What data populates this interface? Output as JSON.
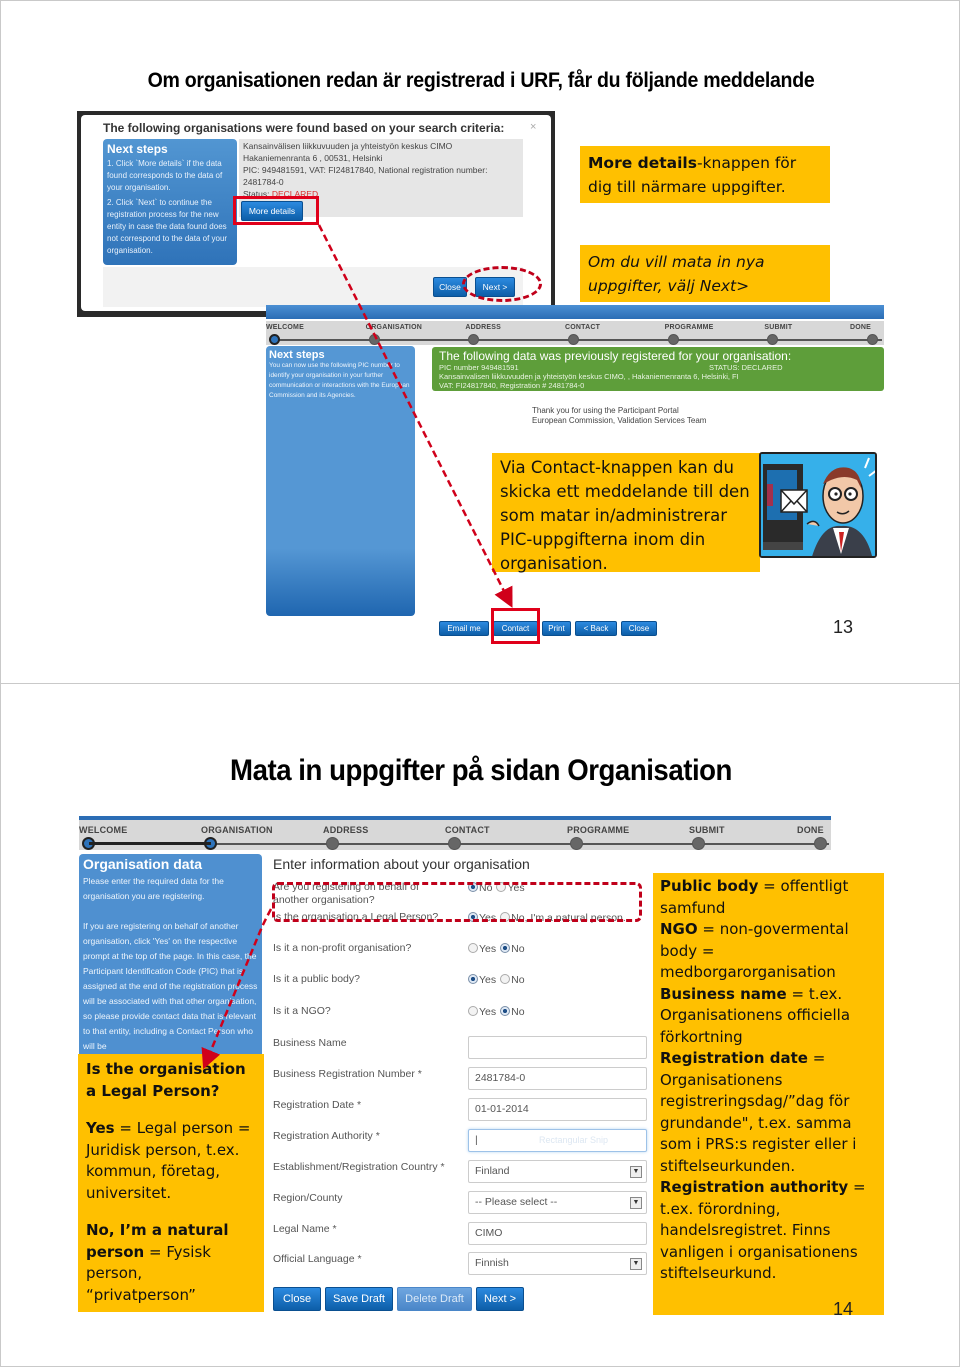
{
  "slide1": {
    "title": "Om organisationen redan är registrerad i URF, får du följande meddelande",
    "dialog": {
      "title": "The following organisations were found based on your search criteria:",
      "close_icon": "×",
      "next_steps_heading": "Next steps",
      "next_steps_1": "1. Click `More details` if the data found corresponds to the data of your organisation.",
      "next_steps_2": "2. Click `Next` to continue the registration process for the new entity in case the data found does not correspond to the data of your organisation.",
      "org_name": "Kansainvälisen liikkuvuuden ja yhteistyön keskus CIMO",
      "org_address": "Hakaniemenranta 6 , 00531, Helsinki",
      "org_ids": "PIC: 949481591, VAT: FI24817840, National registration number: 2481784-0",
      "status_label": "Status: ",
      "status_value": "DECLARED",
      "more_details_button": "More details",
      "close_button": "Close",
      "next_button": "Next >"
    },
    "callout_more_details_bold": "More details",
    "callout_more_details_rest": "-knappen för dig till närmare uppgifter.",
    "callout_next": "Om du vill mata in nya uppgifter, välj Next>",
    "wizard_steps": [
      "WELCOME",
      "ORGANISATION",
      "ADDRESS",
      "CONTACT",
      "PROGRAMME",
      "SUBMIT",
      "DONE"
    ],
    "next_steps_panel": {
      "heading": "Next steps",
      "text": "You can now use the following PIC number to identify your organisation in your further communication or interactions with the European Commission and its Agencies."
    },
    "registered_box": {
      "title": "The following data was previously registered for your organisation:",
      "pic": "PIC number 949481591",
      "status": "STATUS: DECLARED",
      "address": "Kansainvalisen liikkuvuuden ja yhteistyön keskus CIMO, , Hakaniemenranta 6, Helsinki, FI",
      "vat": "VAT: FI24817840, Registration # 2481784-0"
    },
    "thanks_line1": "Thank you for using the Participant Portal",
    "thanks_line2": "European Commission, Validation Services Team",
    "callout_contact": "Via Contact-knappen kan du skicka ett meddelande till den som matar in/administrerar PIC-uppgifterna inom din organisation.",
    "buttons": [
      "Email me",
      "Contact",
      "Print",
      "< Back",
      "Close"
    ],
    "page_number": "13"
  },
  "slide2": {
    "title": "Mata in uppgifter på sidan Organisation",
    "wizard_steps": [
      "WELCOME",
      "ORGANISATION",
      "ADDRESS",
      "CONTACT",
      "PROGRAMME",
      "SUBMIT",
      "DONE"
    ],
    "org_panel": {
      "heading": "Organisation data",
      "text1": "Please enter the required data for the organisation you are registering.",
      "text2": "If you are registering on behalf of another organisation, click 'Yes' on the respective prompt at the top of the page. In this case, the Participant Identification Code (PIC) that is assigned at the end of the registration process will be associated with that other organisation, so please provide contact data that is relevant to that entity, including a Contact Person who will be"
    },
    "form_title": "Enter information about your organisation",
    "questions": [
      {
        "label": "Are you registering on behalf of another organisation?",
        "options": [
          "No",
          "Yes"
        ],
        "selected": "No"
      },
      {
        "label": "Is the organisation a Legal Person?",
        "options": [
          "Yes",
          "No, I'm a natural person."
        ],
        "selected": "Yes"
      },
      {
        "label": "Is it a non-profit organisation?",
        "options": [
          "Yes",
          "No"
        ],
        "selected": "No"
      },
      {
        "label": "Is it a public body?",
        "options": [
          "Yes",
          "No"
        ],
        "selected": "Yes"
      },
      {
        "label": "Is it a NGO?",
        "options": [
          "Yes",
          "No"
        ],
        "selected": "No"
      }
    ],
    "fields": [
      {
        "label": "Business Name",
        "value": ""
      },
      {
        "label": "Business Registration Number *",
        "value": "2481784-0"
      },
      {
        "label": "Registration Date *",
        "value": "01-01-2014"
      },
      {
        "label": "Registration Authority *",
        "value": "|",
        "ghost": "Rectangular Snip"
      },
      {
        "label": "Establishment/Registration Country *",
        "value": "Finland"
      },
      {
        "label": "Region/County",
        "value": "-- Please select --"
      },
      {
        "label": "Legal Name *",
        "value": "CIMO"
      },
      {
        "label": "Official Language *",
        "value": "Finnish"
      }
    ],
    "buttons": [
      "Close",
      "Save Draft",
      "Delete Draft",
      "Next >"
    ],
    "callout_left": {
      "heading": "Is the organisation a Legal Person?",
      "yes_bold": "Yes",
      "yes_rest": " = Legal person = Juridisk person, t.ex. kommun, företag, universitet.",
      "no_bold": "No, I’m a natural person",
      "no_rest": " = Fysisk person, “privatperson”"
    },
    "callout_right": [
      {
        "bold": "Public body",
        "rest": " = offentligt samfund"
      },
      {
        "bold": "NGO",
        "rest": " = non-govermental body = medborgarorganisation"
      },
      {
        "bold": "Business name",
        "rest": " = t.ex. Organisationens officiella förkortning"
      },
      {
        "bold": "Registration date",
        "rest": " = Organisationens registreringsdag/”dag för grundande\", t.ex. samma som i PRS:s register eller i stiftelseurkunden."
      },
      {
        "bold": "Registration authority",
        "rest": " = t.ex. förordning, handelsregistret. Finns vanligen i organisationens stiftelseurkund."
      }
    ],
    "page_number": "14"
  }
}
